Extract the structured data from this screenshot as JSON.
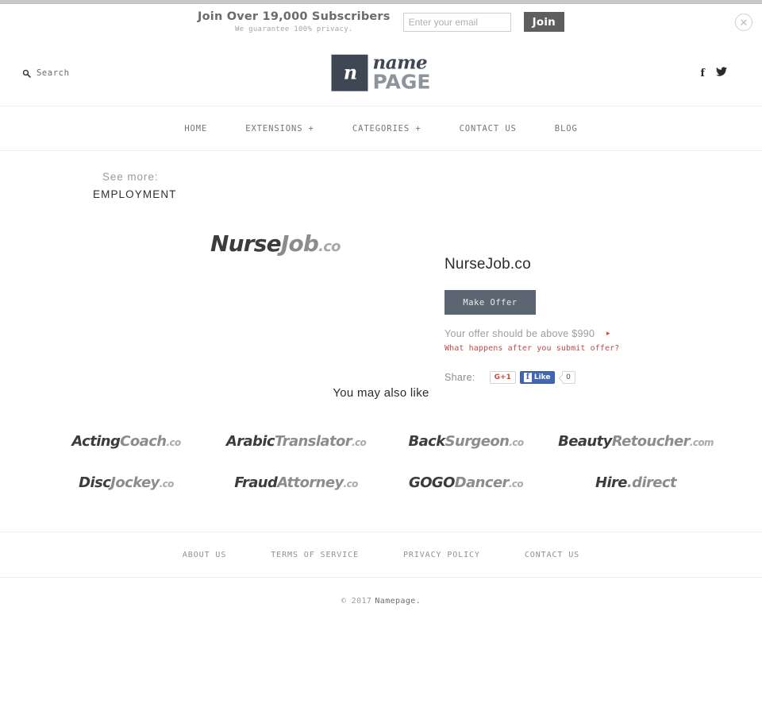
{
  "banner": {
    "title": "Join Over 19,000 Subscribers",
    "subtitle": "We guarantee 100% privacy.",
    "email_placeholder": "Enter your email",
    "email_value": "",
    "join_label": "Join",
    "close_glyph": "✕"
  },
  "header": {
    "search_label": "Search",
    "logo": {
      "mark_letter": "n",
      "name": "name",
      "page": "PAGE"
    },
    "social": [
      {
        "name": "facebook-icon",
        "glyph": "f"
      },
      {
        "name": "twitter-icon",
        "glyph": "bird"
      }
    ]
  },
  "nav": {
    "items": [
      {
        "label": "HOME"
      },
      {
        "label": "EXTENSIONS +"
      },
      {
        "label": "CATEGORIES +"
      },
      {
        "label": "CONTACT US"
      },
      {
        "label": "BLOG"
      }
    ]
  },
  "seemore": {
    "label": "See more:",
    "category": "EMPLOYMENT"
  },
  "listing": {
    "logo": {
      "part1": "Nurse",
      "part2": "Job",
      "tld": ".co"
    },
    "title": "NurseJob.co",
    "make_offer_label": "Make Offer",
    "offer_note": "Your offer should be above $990",
    "offer_arrow": "▸",
    "offer_link": "What happens after you submit offer?",
    "share_label": "Share:",
    "gplus_label": "G+1",
    "fb_like_label": "Like",
    "fb_like_count": "0"
  },
  "related": {
    "title": "You may also like",
    "items": [
      {
        "part1": "Acting",
        "part2": "Coach",
        "tld": ".co"
      },
      {
        "part1": "Arabic",
        "part2": "Translator",
        "tld": ".co"
      },
      {
        "part1": "Back",
        "part2": "Surgeon",
        "tld": ".co"
      },
      {
        "part1": "Beauty",
        "part2": "Retoucher",
        "tld": ".com"
      },
      {
        "part1": "Disc",
        "part2": "Jockey",
        "tld": ".co"
      },
      {
        "part1": "Fraud",
        "part2": "Attorney",
        "tld": ".co"
      },
      {
        "part1": "GOGO",
        "part2": "Dancer",
        "tld": ".co"
      },
      {
        "part1": "Hire",
        "part2": "",
        "tld": ".direct"
      }
    ]
  },
  "footer": {
    "links": [
      {
        "label": "ABOUT US"
      },
      {
        "label": "TERMS OF SERVICE"
      },
      {
        "label": "PRIVACY POLICY"
      },
      {
        "label": "CONTACT US"
      }
    ],
    "copyright_prefix": "© 2017",
    "copyright_brand": "Namepage."
  },
  "colors": {
    "logo_dark": "#3f4754",
    "logo_gray": "#8d949c",
    "button": "#5c6673",
    "accent_red": "#bb4a4a",
    "fb_blue": "#4267b2",
    "gplus_red": "#d14836"
  }
}
